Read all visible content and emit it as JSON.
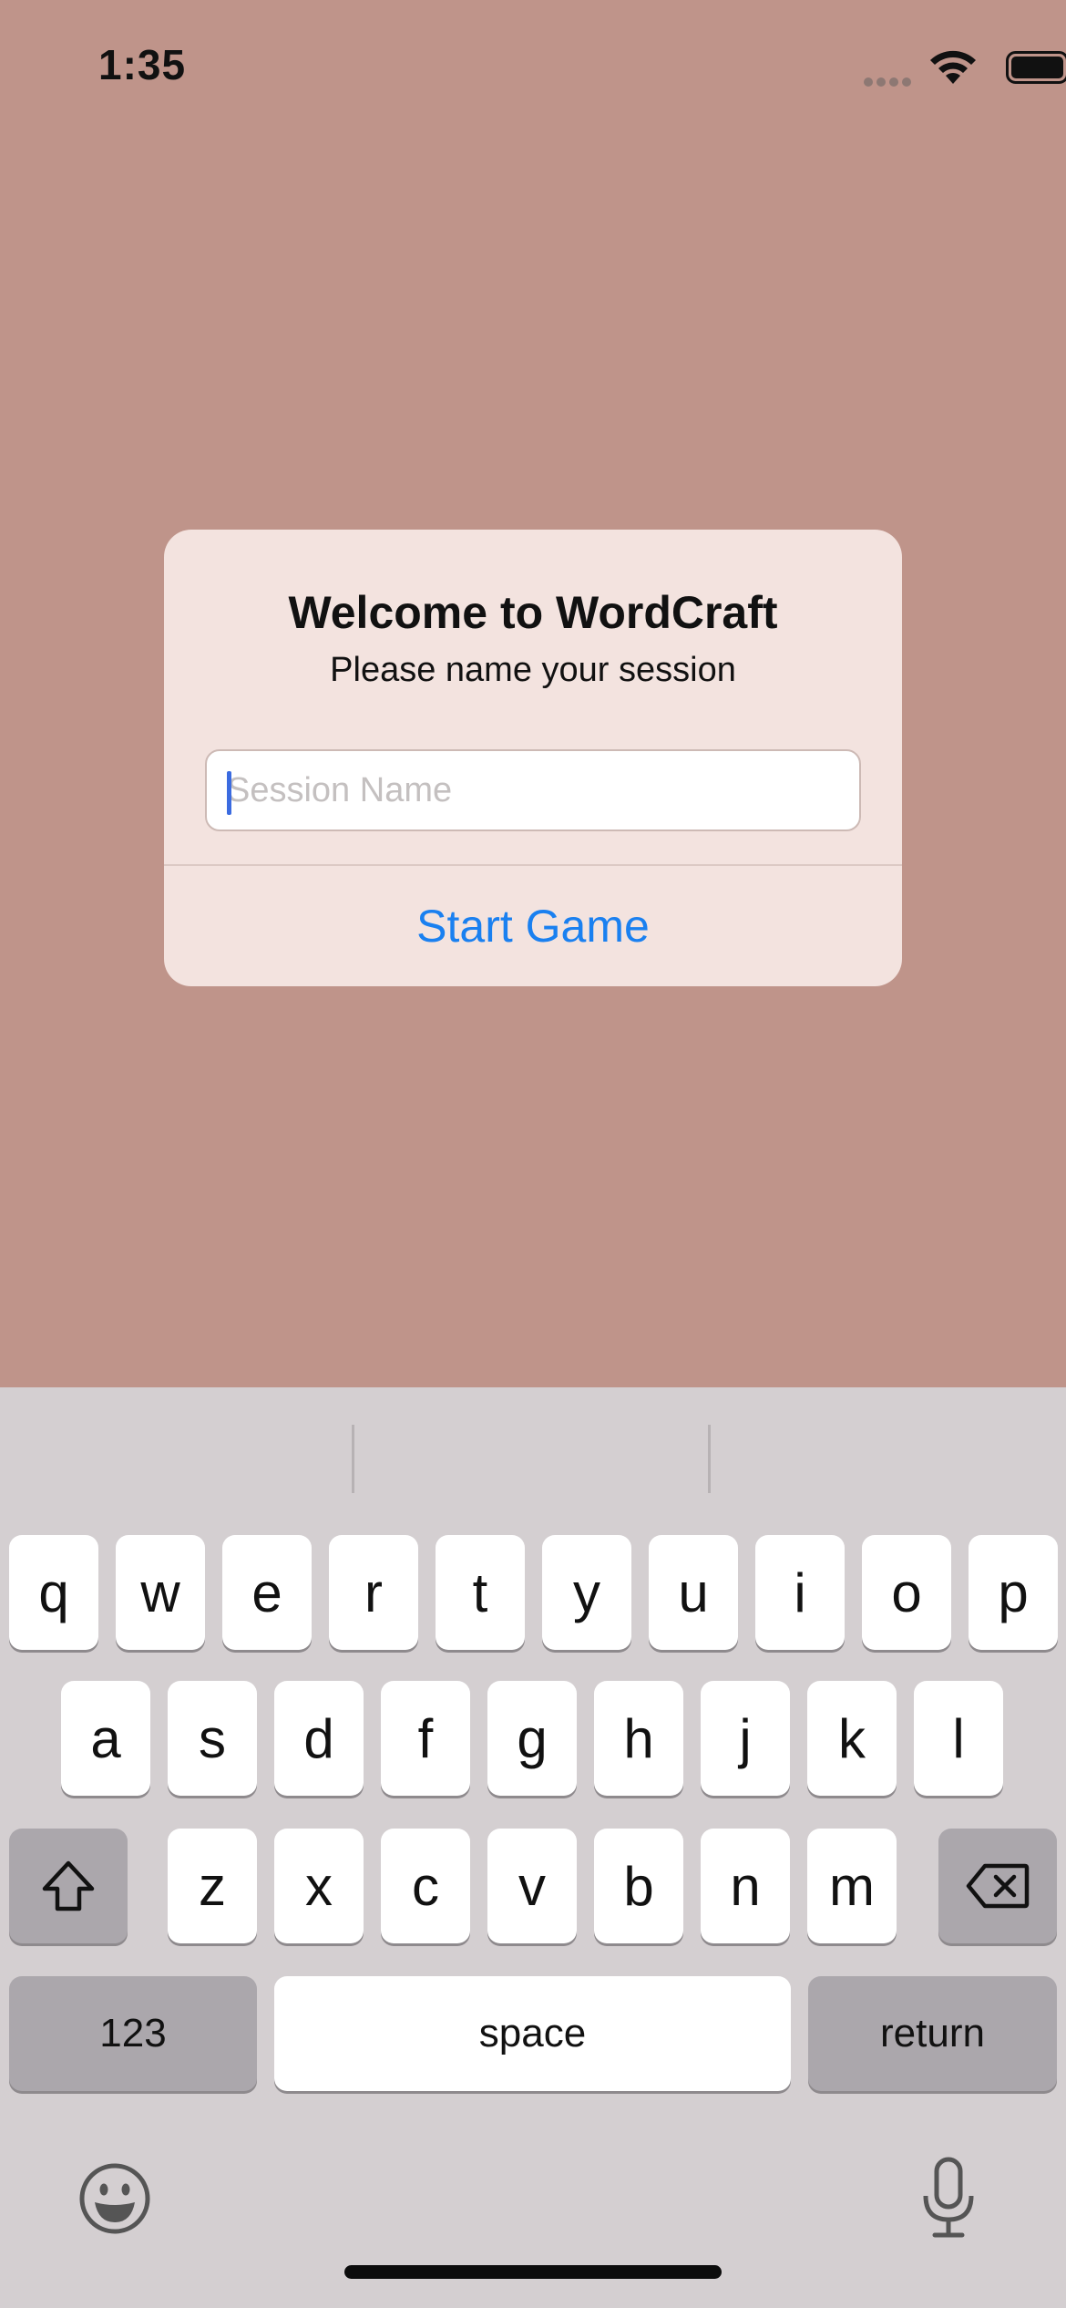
{
  "status_bar": {
    "time": "1:35"
  },
  "dialog": {
    "title": "Welcome to WordCraft",
    "subtitle": "Please name your session",
    "session_input": {
      "value": "",
      "placeholder": "Session Name"
    },
    "start_button_label": "Start Game"
  },
  "keyboard": {
    "row1": [
      "q",
      "w",
      "e",
      "r",
      "t",
      "y",
      "u",
      "i",
      "o",
      "p"
    ],
    "row2": [
      "a",
      "s",
      "d",
      "f",
      "g",
      "h",
      "j",
      "k",
      "l"
    ],
    "row3": [
      "z",
      "x",
      "c",
      "v",
      "b",
      "n",
      "m"
    ],
    "numbers_label": "123",
    "space_label": "space",
    "return_label": "return",
    "shift_icon": "shift-icon",
    "delete_icon": "delete-icon",
    "emoji_icon": "emoji-icon",
    "mic_icon": "microphone-icon"
  },
  "colors": {
    "background": "#bf948a",
    "dialog_background": "#f3e3df",
    "accent": "#1a80f0",
    "keyboard_background": "#d4cfd1"
  }
}
